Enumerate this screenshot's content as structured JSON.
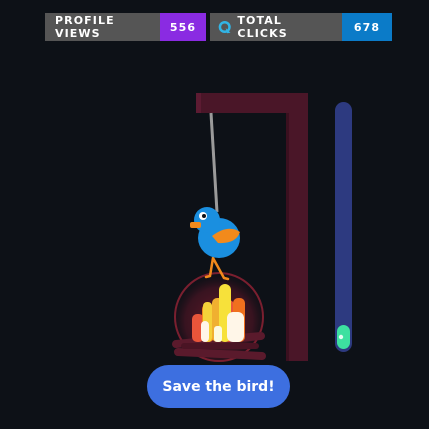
{
  "badges": {
    "profile_views": {
      "label": "PROFILE VIEWS",
      "value": "556",
      "color": "#8a2be2"
    },
    "total_clicks": {
      "label": "TOTAL CLICKS",
      "value": "678",
      "color": "#0b7bc8",
      "icon": "cursor-q-icon"
    }
  },
  "game": {
    "button_label": "Save the bird!",
    "rope_level": 0.1,
    "colors": {
      "background": "#0d1117",
      "gallows": "#4a1628",
      "bird": "#1a8fe0",
      "beak": "#f28a1c",
      "slider_track": "#2d3a80",
      "slider_knob": "#3de0a0",
      "button": "#3d6fe0"
    }
  }
}
